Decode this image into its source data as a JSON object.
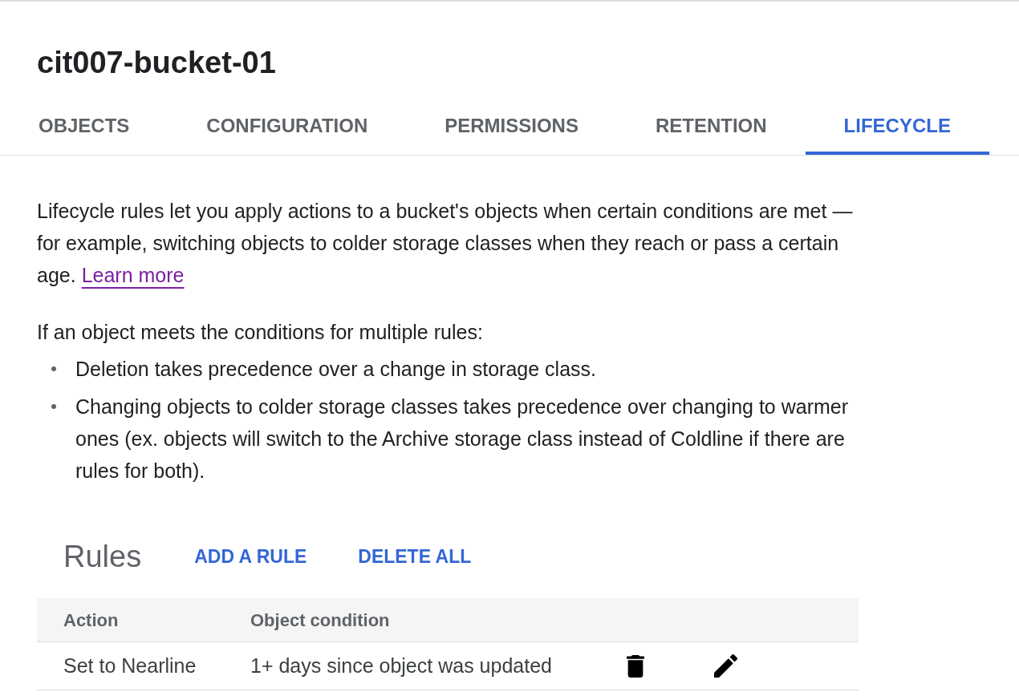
{
  "bucket": {
    "title": "cit007-bucket-01"
  },
  "tabs": [
    {
      "label": "OBJECTS",
      "selected": false
    },
    {
      "label": "CONFIGURATION",
      "selected": false
    },
    {
      "label": "PERMISSIONS",
      "selected": false
    },
    {
      "label": "RETENTION",
      "selected": false
    },
    {
      "label": "LIFECYCLE",
      "selected": true
    }
  ],
  "intro": {
    "text": "Lifecycle rules let you apply actions to a bucket's objects when certain conditions are met — for example, switching objects to colder storage classes when they reach or pass a certain age.",
    "link": "Learn more"
  },
  "precedence": {
    "heading": "If an object meets the conditions for multiple rules:",
    "bullets": [
      "Deletion takes precedence over a change in storage class.",
      "Changing objects to colder storage classes takes precedence over changing to warmer ones (ex. objects will switch to the Archive storage class instead of Coldline if there are rules for both)."
    ]
  },
  "rules": {
    "title": "Rules",
    "actions": [
      "ADD A RULE",
      "DELETE ALL"
    ],
    "table": {
      "columns": [
        "Action",
        "Object condition"
      ],
      "rows": [
        {
          "action": "Set to Nearline",
          "condition": "1+ days since object was updated"
        }
      ]
    }
  }
}
